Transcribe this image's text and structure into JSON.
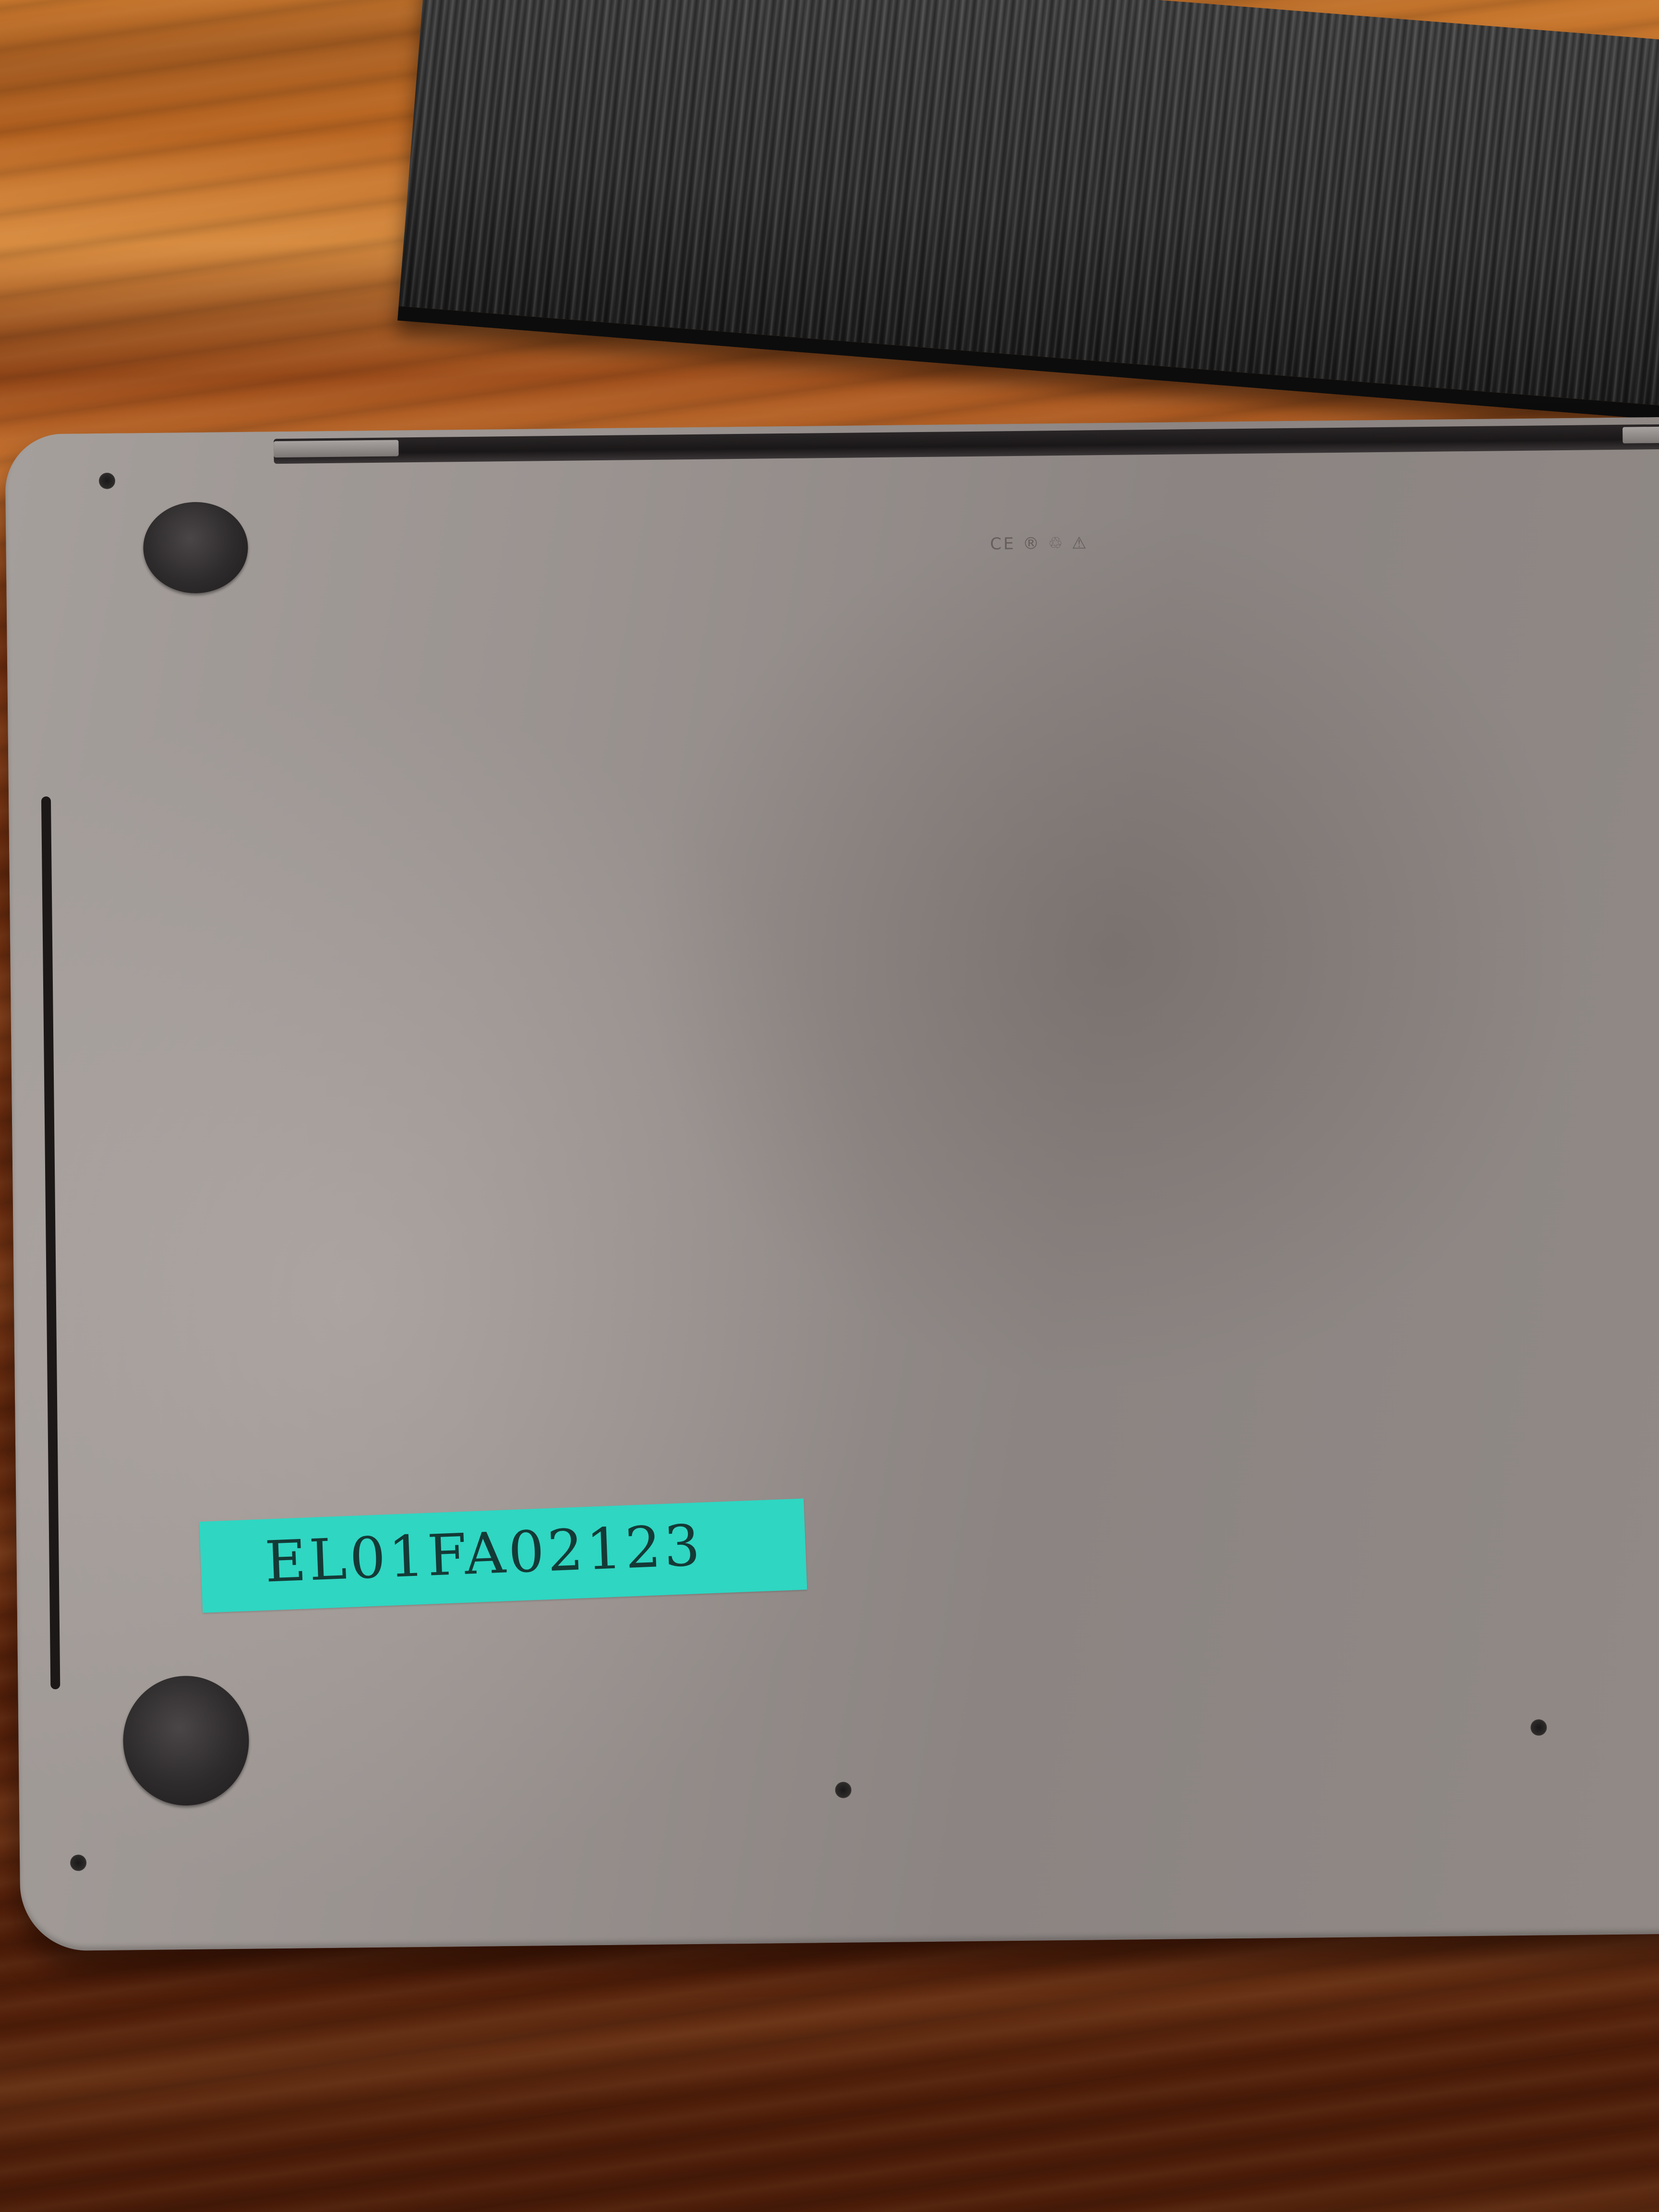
{
  "scene": {
    "subject": "laptop-bottom-case",
    "surface": "wooden-desk"
  },
  "asset_tag": {
    "text": "EL01FA02123",
    "color": "#2fd6c2"
  },
  "regulatory": {
    "line1": "",
    "line2": "",
    "marks": "CE ® ♲ ⚠"
  },
  "colors": {
    "case": "#9a9390",
    "desk": "#7e3612",
    "box": "#2a2a2a"
  }
}
